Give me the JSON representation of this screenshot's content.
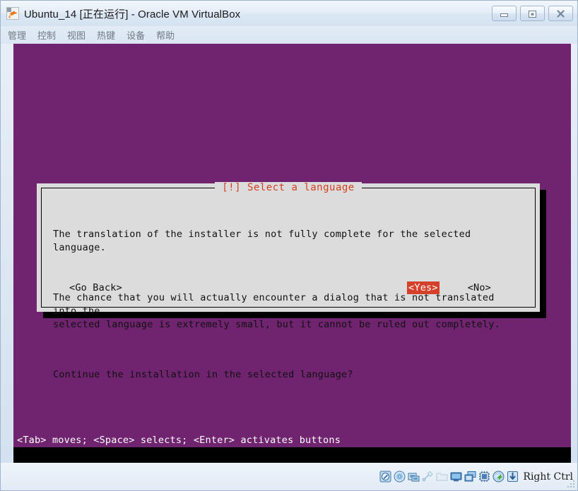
{
  "window": {
    "title": "Ubuntu_14 [正在运行] - Oracle VM VirtualBox",
    "app_icon": "virtualbox-icon",
    "controls": {
      "minimize_label": "minimize-icon",
      "restore_label": "restore-icon",
      "close_label": "close-icon"
    }
  },
  "menu": {
    "items": [
      {
        "label": "管理",
        "name": "menu-item-manage"
      },
      {
        "label": "控制",
        "name": "menu-item-machine"
      },
      {
        "label": "视图",
        "name": "menu-item-view"
      },
      {
        "label": "热键",
        "name": "menu-item-input"
      },
      {
        "label": "设备",
        "name": "menu-item-devices"
      },
      {
        "label": "帮助",
        "name": "menu-item-help"
      }
    ]
  },
  "vm": {
    "background_color": "#702470",
    "dialog": {
      "title": "[!] Select a language",
      "title_color": "#d43f1f",
      "background_color": "#dcdcdc",
      "paragraphs": [
        "The translation of the installer is not fully complete for the selected language.",
        "The chance that you will actually encounter a dialog that is not translated into the\nselected language is extremely small, but it cannot be ruled out completely.",
        "Continue the installation in the selected language?"
      ],
      "buttons": [
        {
          "label": "<Go Back>",
          "selected": false
        },
        {
          "label": "<Yes>",
          "selected": true
        },
        {
          "label": "<No>",
          "selected": false
        }
      ],
      "selected_color": "#d5402a"
    },
    "status_line": "<Tab> moves; <Space> selects; <Enter> activates buttons"
  },
  "status_bar": {
    "icons": [
      {
        "name": "hard-disk-icon",
        "dim": false
      },
      {
        "name": "optical-disk-icon",
        "dim": false
      },
      {
        "name": "floppy-disk-icon",
        "dim": false
      },
      {
        "name": "usb-icon",
        "dim": true
      },
      {
        "name": "shared-folder-icon",
        "dim": true
      },
      {
        "name": "display-icon",
        "dim": false
      },
      {
        "name": "video-capture-icon",
        "dim": false
      },
      {
        "name": "processor-icon",
        "dim": false
      },
      {
        "name": "network-icon",
        "dim": false
      },
      {
        "name": "mouse-integration-icon",
        "dim": false
      }
    ],
    "host_key": "Right Ctrl"
  }
}
